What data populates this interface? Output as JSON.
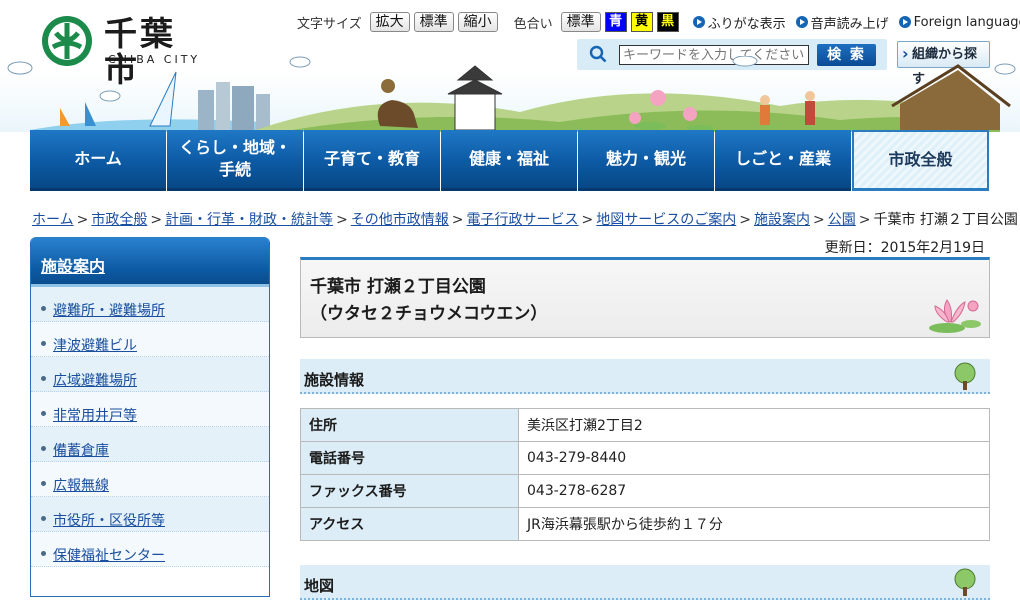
{
  "header": {
    "city_name": "千葉市",
    "city_name_en": "CHIBA CITY",
    "font_size_label": "文字サイズ",
    "font_size_buttons": [
      "拡大",
      "標準",
      "縮小"
    ],
    "color_label": "色合い",
    "color_buttons": [
      {
        "label": "標準",
        "color": "#ffffff"
      },
      {
        "label": "青",
        "color": "#0000ff"
      },
      {
        "label": "黄",
        "color": "#ffff00"
      },
      {
        "label": "黒",
        "color": "#000000"
      }
    ],
    "links": [
      "ふりがな表示",
      "音声読み上げ",
      "Foreign language"
    ],
    "search_placeholder": "キーワードを入力してください",
    "search_button": "検 索",
    "org_search": "組織から探す"
  },
  "nav": {
    "items": [
      "ホーム",
      "くらし・地域・\n手続",
      "子育て・教育",
      "健康・福祉",
      "魅力・観光",
      "しごと・産業",
      "市政全般"
    ],
    "current": "市政全般",
    "accent_color": "#0d5aa4"
  },
  "breadcrumb": {
    "links": [
      "ホーム",
      "市政全般",
      "計画・行革・財政・統計等",
      "その他市政情報",
      "電子行政サービス",
      "地図サービスのご案内",
      "施設案内",
      "公園"
    ],
    "current": "千葉市 打瀬２丁目公園",
    "separator": ">"
  },
  "updated": "更新日：2015年2月19日",
  "sidebar": {
    "title": "施設案内",
    "items": [
      "避難所・避難場所",
      "津波避難ビル",
      "広域避難場所",
      "非常用井戸等",
      "備蓄倉庫",
      "広報無線",
      "市役所・区役所等",
      "保健福祉センター"
    ]
  },
  "page": {
    "title_line1": "千葉市 打瀬２丁目公園",
    "title_line2": "（ウタセ２チョウメコウエン）"
  },
  "facility": {
    "heading": "施設情報",
    "rows": [
      {
        "label": "住所",
        "value": "美浜区打瀬2丁目2"
      },
      {
        "label": "電話番号",
        "value": "043-279-8440"
      },
      {
        "label": "ファックス番号",
        "value": "043-278-6287"
      },
      {
        "label": "アクセス",
        "value": "JR海浜幕張駅から徒歩約１７分"
      }
    ]
  },
  "map": {
    "heading": "地図"
  }
}
